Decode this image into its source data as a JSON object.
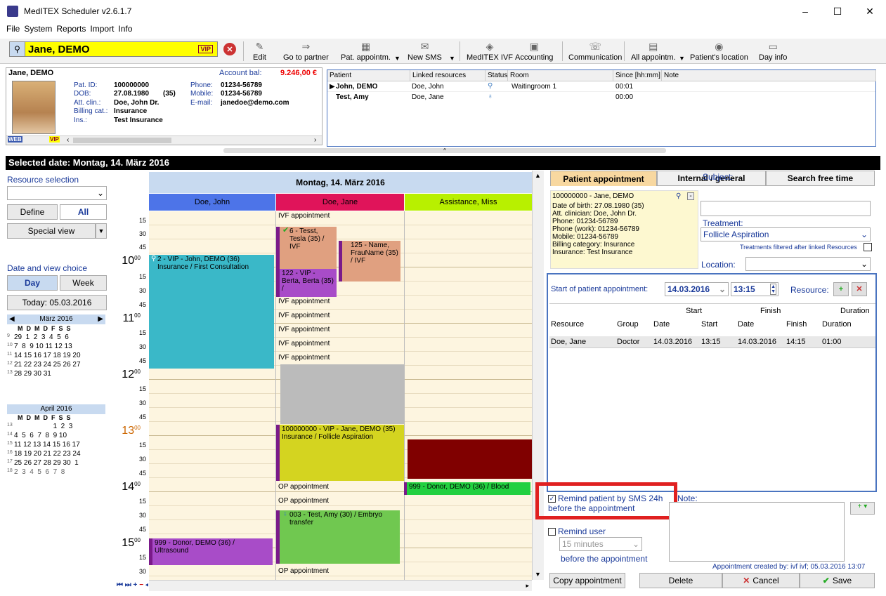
{
  "app": {
    "title": "MedITEX Scheduler v2.6.1.7",
    "controls": [
      "–",
      "☐",
      "✕"
    ]
  },
  "menu": [
    "File",
    "System",
    "Reports",
    "Import",
    "Info"
  ],
  "toolbar": {
    "patient": "Jane, DEMO",
    "vip": "VIP",
    "items": [
      {
        "label": "Edit",
        "icon": "pencil-icon"
      },
      {
        "label": "Go to partner",
        "icon": "partner-icon"
      },
      {
        "label": "Pat. appointm.",
        "icon": "appointment-icon"
      },
      {
        "label": "New SMS",
        "icon": "sms-icon"
      },
      {
        "label": "MedITEX IVF",
        "icon": "ivf-icon"
      },
      {
        "label": "Accounting",
        "icon": "accounting-icon"
      },
      {
        "label": "Communication",
        "icon": "communication-icon"
      },
      {
        "label": "All appointm.",
        "icon": "all-appointments-icon"
      },
      {
        "label": "Patient's location",
        "icon": "location-icon"
      },
      {
        "label": "Day info",
        "icon": "dayinfo-icon"
      }
    ]
  },
  "patient": {
    "name": "Jane, DEMO",
    "account_label": "Account bal:",
    "account_value": "9.246,00 €",
    "fields": [
      [
        "Pat. ID:",
        "100000000"
      ],
      [
        "DOB:",
        "27.08.1980"
      ],
      [
        "Att. clin.:",
        "Doe, John Dr."
      ],
      [
        "Billing cat.:",
        "Insurance"
      ],
      [
        "Ins.:",
        "Test Insurance"
      ]
    ],
    "age": "(35)",
    "contact": [
      [
        "Phone:",
        "01234-56789"
      ],
      [
        "Mobile:",
        "01234-56789"
      ],
      [
        "E-mail:",
        "janedoe@demo.com"
      ]
    ],
    "web": "WEB",
    "vip": "VIP"
  },
  "patlist": {
    "headers": [
      "Patient",
      "Linked resources",
      "Status",
      "Room",
      "Since [hh:mm]",
      "Note"
    ],
    "rows": [
      [
        "John, DEMO",
        "Doe, John",
        "",
        "Waitingroom 1",
        "00:01",
        ""
      ],
      [
        "Test, Amy",
        "Doe, Jane",
        "",
        "",
        "00:00",
        ""
      ]
    ]
  },
  "selected_date": "Selected date:  Montag, 14. März 2016",
  "left": {
    "resource_selection": "Resource selection",
    "define": "Define",
    "all": "All",
    "special_view": "Special view",
    "date_view": "Date and view choice",
    "day": "Day",
    "week": "Week",
    "today": "Today: 05.03.2016",
    "cal1": {
      "month": "März 2016",
      "head": "M  D  M  D  F  S  S",
      "rows": [
        [
          "9",
          "29  1  2  3  4  5  6"
        ],
        [
          "10",
          "7  8  9 10 11 12 13"
        ],
        [
          "11",
          "14 15 16 17 18 19 20"
        ],
        [
          "12",
          "21 22 23 24 25 26 27"
        ],
        [
          "13",
          "28 29 30 31"
        ]
      ]
    },
    "cal2": {
      "month": "April 2016",
      "head": "M  D  M  D  F  S  S",
      "rows": [
        [
          "13",
          "                    1  2  3"
        ],
        [
          "14",
          "4  5  6  7  8  9 10"
        ],
        [
          "15",
          "11 12 13 14 15 16 17"
        ],
        [
          "16",
          "18 19 20 21 22 23 24"
        ],
        [
          "17",
          "25 26 27 28 29 30  1"
        ],
        [
          "18",
          "2  3  4  5  6  7  8"
        ]
      ]
    }
  },
  "schedule": {
    "date": "Montag, 14. März 2016",
    "columns": [
      "Doe, John",
      "Doe, Jane",
      "Assistance, Miss"
    ],
    "hours": [
      "10",
      "11",
      "12",
      "13",
      "14",
      "15"
    ],
    "minutes": [
      "15",
      "30",
      "45"
    ],
    "events": [
      {
        "text": "IVF appointment"
      },
      {
        "text": "6 - Tesst, Tesla (35) / IVF"
      },
      {
        "text": "125 - Name, FrauName (35) / IVF"
      },
      {
        "text": "2 - VIP - John, DEMO (36) Insurance / First Consultation"
      },
      {
        "text": "122 - VIP - Berta, Berta (35) /"
      },
      {
        "text": "IVF appointment"
      },
      {
        "text": "IVF appointment"
      },
      {
        "text": "IVF appointment"
      },
      {
        "text": "IVF appointment"
      },
      {
        "text": "IVF appointment"
      },
      {
        "text": "100000000 - VIP - Jane, DEMO (35) Insurance / Follicle Aspiration"
      },
      {
        "text": "OP appointment"
      },
      {
        "text": "999 - Donor, DEMO (36) / Blood"
      },
      {
        "text": "OP appointment"
      },
      {
        "text": "003 - Test, Amy (30) / Embryo transfer"
      },
      {
        "text": "999 - Donor, DEMO (36) / Ultrasound"
      },
      {
        "text": "OP appointment"
      }
    ]
  },
  "right": {
    "tabs": [
      "Patient appointment",
      "Internal / general",
      "Search free time"
    ],
    "patcard": [
      "100000000 - Jane, DEMO",
      "Date of birth: 27.08.1980 (35)",
      "Att. clinician: Doe, John Dr.",
      "Phone: 01234-56789",
      "Phone (work): 01234-56789",
      "Mobile: 01234-56789",
      "Billing category: Insurance",
      "Insurance: Test Insurance"
    ],
    "subject_label": "Subject:",
    "treatment_label": "Treatment:",
    "treatment": "Follicle Aspiration",
    "filter_note": "Treatments filtered after linked Resources",
    "location_label": "Location:",
    "start_label": "Start of patient appointment:",
    "start_date": "14.03.2016",
    "start_time": "13:15",
    "resource_label": "Resource:",
    "table": {
      "group1": [
        "Start",
        "Finish",
        "Duration"
      ],
      "headers": [
        "Resource",
        "Group",
        "Date",
        "Start",
        "Date",
        "Finish",
        "Duration"
      ],
      "row": [
        "Doe, Jane",
        "Doctor",
        "14.03.2016",
        "13:15",
        "14.03.2016",
        "14:15",
        "01:00"
      ]
    },
    "remind_sms": "Remind patient by SMS 24h before the appointment",
    "note_label": "Note:",
    "remind_user": "Remind user",
    "remind_minutes": "15 minutes",
    "before": "before the appointment",
    "created": "Appointment created by: ivf ivf; 05.03.2016 13:07",
    "copy": "Copy appointment",
    "delete": "Delete",
    "cancel": "Cancel",
    "save": "Save"
  }
}
